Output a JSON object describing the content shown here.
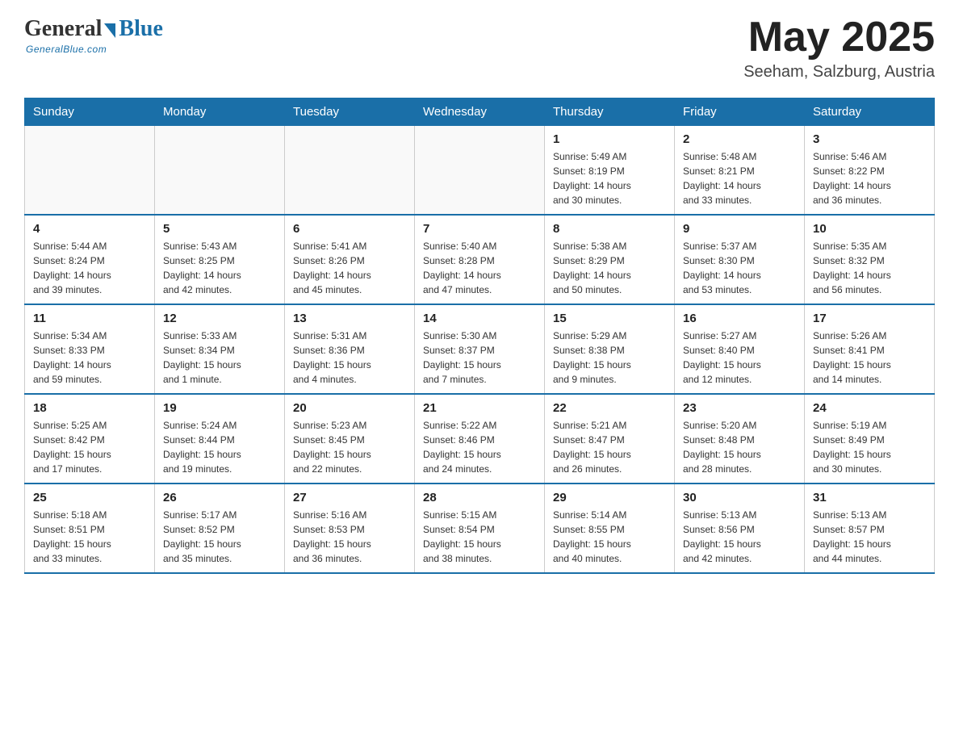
{
  "logo": {
    "general": "General",
    "blue": "Blue",
    "tagline": "GeneralBlue.com"
  },
  "title": {
    "month_year": "May 2025",
    "location": "Seeham, Salzburg, Austria"
  },
  "weekdays": [
    "Sunday",
    "Monday",
    "Tuesday",
    "Wednesday",
    "Thursday",
    "Friday",
    "Saturday"
  ],
  "weeks": [
    [
      {
        "day": "",
        "info": ""
      },
      {
        "day": "",
        "info": ""
      },
      {
        "day": "",
        "info": ""
      },
      {
        "day": "",
        "info": ""
      },
      {
        "day": "1",
        "info": "Sunrise: 5:49 AM\nSunset: 8:19 PM\nDaylight: 14 hours\nand 30 minutes."
      },
      {
        "day": "2",
        "info": "Sunrise: 5:48 AM\nSunset: 8:21 PM\nDaylight: 14 hours\nand 33 minutes."
      },
      {
        "day": "3",
        "info": "Sunrise: 5:46 AM\nSunset: 8:22 PM\nDaylight: 14 hours\nand 36 minutes."
      }
    ],
    [
      {
        "day": "4",
        "info": "Sunrise: 5:44 AM\nSunset: 8:24 PM\nDaylight: 14 hours\nand 39 minutes."
      },
      {
        "day": "5",
        "info": "Sunrise: 5:43 AM\nSunset: 8:25 PM\nDaylight: 14 hours\nand 42 minutes."
      },
      {
        "day": "6",
        "info": "Sunrise: 5:41 AM\nSunset: 8:26 PM\nDaylight: 14 hours\nand 45 minutes."
      },
      {
        "day": "7",
        "info": "Sunrise: 5:40 AM\nSunset: 8:28 PM\nDaylight: 14 hours\nand 47 minutes."
      },
      {
        "day": "8",
        "info": "Sunrise: 5:38 AM\nSunset: 8:29 PM\nDaylight: 14 hours\nand 50 minutes."
      },
      {
        "day": "9",
        "info": "Sunrise: 5:37 AM\nSunset: 8:30 PM\nDaylight: 14 hours\nand 53 minutes."
      },
      {
        "day": "10",
        "info": "Sunrise: 5:35 AM\nSunset: 8:32 PM\nDaylight: 14 hours\nand 56 minutes."
      }
    ],
    [
      {
        "day": "11",
        "info": "Sunrise: 5:34 AM\nSunset: 8:33 PM\nDaylight: 14 hours\nand 59 minutes."
      },
      {
        "day": "12",
        "info": "Sunrise: 5:33 AM\nSunset: 8:34 PM\nDaylight: 15 hours\nand 1 minute."
      },
      {
        "day": "13",
        "info": "Sunrise: 5:31 AM\nSunset: 8:36 PM\nDaylight: 15 hours\nand 4 minutes."
      },
      {
        "day": "14",
        "info": "Sunrise: 5:30 AM\nSunset: 8:37 PM\nDaylight: 15 hours\nand 7 minutes."
      },
      {
        "day": "15",
        "info": "Sunrise: 5:29 AM\nSunset: 8:38 PM\nDaylight: 15 hours\nand 9 minutes."
      },
      {
        "day": "16",
        "info": "Sunrise: 5:27 AM\nSunset: 8:40 PM\nDaylight: 15 hours\nand 12 minutes."
      },
      {
        "day": "17",
        "info": "Sunrise: 5:26 AM\nSunset: 8:41 PM\nDaylight: 15 hours\nand 14 minutes."
      }
    ],
    [
      {
        "day": "18",
        "info": "Sunrise: 5:25 AM\nSunset: 8:42 PM\nDaylight: 15 hours\nand 17 minutes."
      },
      {
        "day": "19",
        "info": "Sunrise: 5:24 AM\nSunset: 8:44 PM\nDaylight: 15 hours\nand 19 minutes."
      },
      {
        "day": "20",
        "info": "Sunrise: 5:23 AM\nSunset: 8:45 PM\nDaylight: 15 hours\nand 22 minutes."
      },
      {
        "day": "21",
        "info": "Sunrise: 5:22 AM\nSunset: 8:46 PM\nDaylight: 15 hours\nand 24 minutes."
      },
      {
        "day": "22",
        "info": "Sunrise: 5:21 AM\nSunset: 8:47 PM\nDaylight: 15 hours\nand 26 minutes."
      },
      {
        "day": "23",
        "info": "Sunrise: 5:20 AM\nSunset: 8:48 PM\nDaylight: 15 hours\nand 28 minutes."
      },
      {
        "day": "24",
        "info": "Sunrise: 5:19 AM\nSunset: 8:49 PM\nDaylight: 15 hours\nand 30 minutes."
      }
    ],
    [
      {
        "day": "25",
        "info": "Sunrise: 5:18 AM\nSunset: 8:51 PM\nDaylight: 15 hours\nand 33 minutes."
      },
      {
        "day": "26",
        "info": "Sunrise: 5:17 AM\nSunset: 8:52 PM\nDaylight: 15 hours\nand 35 minutes."
      },
      {
        "day": "27",
        "info": "Sunrise: 5:16 AM\nSunset: 8:53 PM\nDaylight: 15 hours\nand 36 minutes."
      },
      {
        "day": "28",
        "info": "Sunrise: 5:15 AM\nSunset: 8:54 PM\nDaylight: 15 hours\nand 38 minutes."
      },
      {
        "day": "29",
        "info": "Sunrise: 5:14 AM\nSunset: 8:55 PM\nDaylight: 15 hours\nand 40 minutes."
      },
      {
        "day": "30",
        "info": "Sunrise: 5:13 AM\nSunset: 8:56 PM\nDaylight: 15 hours\nand 42 minutes."
      },
      {
        "day": "31",
        "info": "Sunrise: 5:13 AM\nSunset: 8:57 PM\nDaylight: 15 hours\nand 44 minutes."
      }
    ]
  ]
}
